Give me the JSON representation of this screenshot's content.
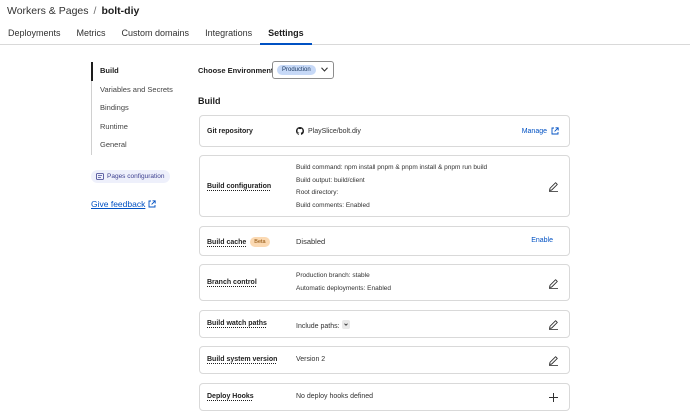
{
  "breadcrumb": {
    "parent": "Workers & Pages",
    "separator": "/",
    "current": "bolt-diy"
  },
  "tabs": [
    {
      "label": "Deployments"
    },
    {
      "label": "Metrics"
    },
    {
      "label": "Custom domains"
    },
    {
      "label": "Integrations"
    },
    {
      "label": "Settings",
      "active": true
    }
  ],
  "sidenav": {
    "items": [
      {
        "label": "Build",
        "active": true
      },
      {
        "label": "Variables and Secrets"
      },
      {
        "label": "Bindings"
      },
      {
        "label": "Runtime"
      },
      {
        "label": "General"
      }
    ],
    "pill": "Pages configuration",
    "feedback": "Give feedback"
  },
  "environment": {
    "label": "Choose Environment:",
    "value": "Production"
  },
  "section_title": "Build",
  "cards": {
    "git": {
      "label": "Git repository",
      "value": "PlaySlice/bolt.diy",
      "action": "Manage"
    },
    "build_config": {
      "label": "Build configuration",
      "lines": [
        "Build command: npm install pnpm & pnpm install & pnpm run build",
        "Build output: build/client",
        "Root directory:",
        "Build comments: Enabled"
      ]
    },
    "build_cache": {
      "label": "Build cache",
      "badge": "Beta",
      "value": "Disabled",
      "action": "Enable"
    },
    "branch_control": {
      "label": "Branch control",
      "lines": [
        "Production branch: stable",
        "Automatic deployments: Enabled"
      ]
    },
    "watch_paths": {
      "label": "Build watch paths",
      "value": "Include paths:"
    },
    "system_version": {
      "label": "Build system version",
      "value": "Version 2"
    },
    "deploy_hooks": {
      "label": "Deploy Hooks",
      "value": "No deploy hooks defined"
    }
  },
  "colors": {
    "accent": "#0051c3",
    "badge_env": "#c7d9f7",
    "badge_beta": "#fbd9b2",
    "border": "#d9d9d9"
  }
}
